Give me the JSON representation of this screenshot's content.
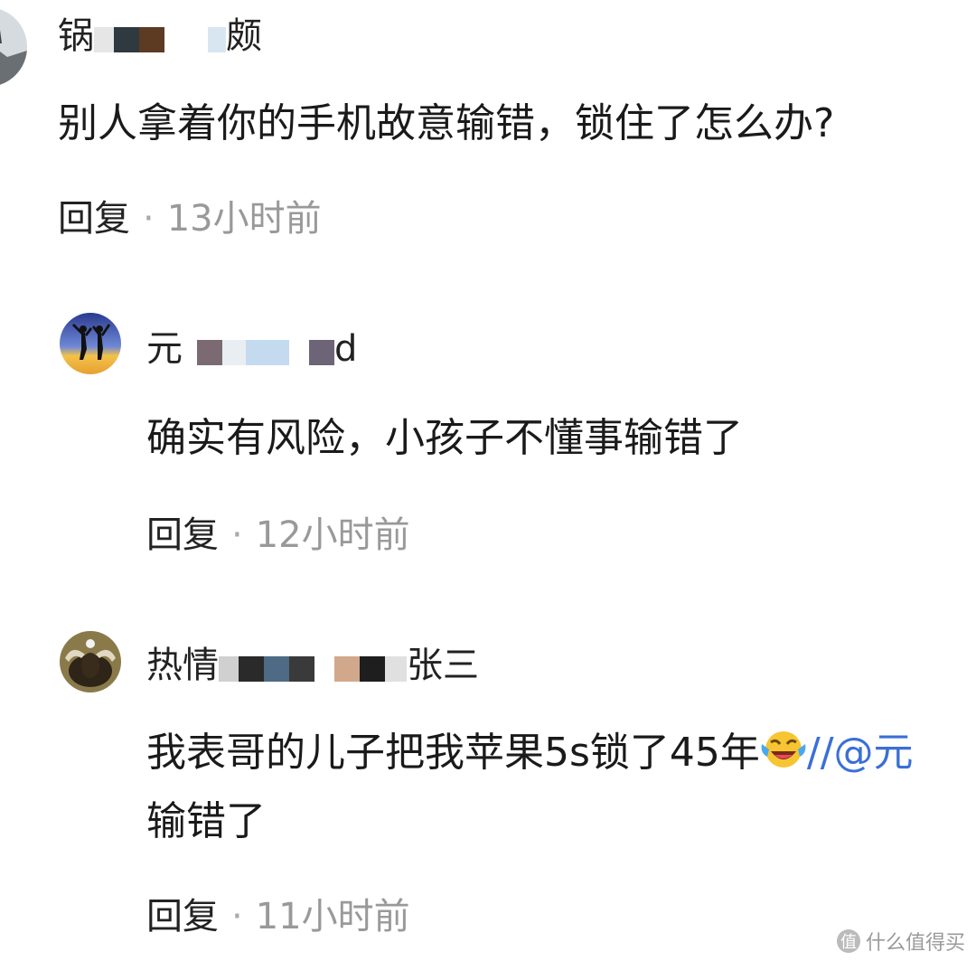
{
  "comments": [
    {
      "name_start": "锅",
      "name_end": "颇",
      "content": "别人拿着你的手机故意输错，锁住了怎么办?",
      "reply_label": "回复",
      "separator": "·",
      "time": "13小时前"
    },
    {
      "name_start": "元",
      "name_end": "d",
      "content": "确实有风险，小孩子不懂事输错了",
      "reply_label": "回复",
      "separator": "·",
      "time": "12小时前"
    },
    {
      "name_start": "热情",
      "name_end": "张三",
      "content_line1": "我表哥的儿子把我苹果5s锁了45年",
      "mention": "//@元",
      "content_line2": "输错了",
      "reply_label": "回复",
      "separator": "·",
      "time": "11小时前"
    }
  ],
  "watermark": {
    "icon": "值",
    "text": "什么值得买"
  }
}
